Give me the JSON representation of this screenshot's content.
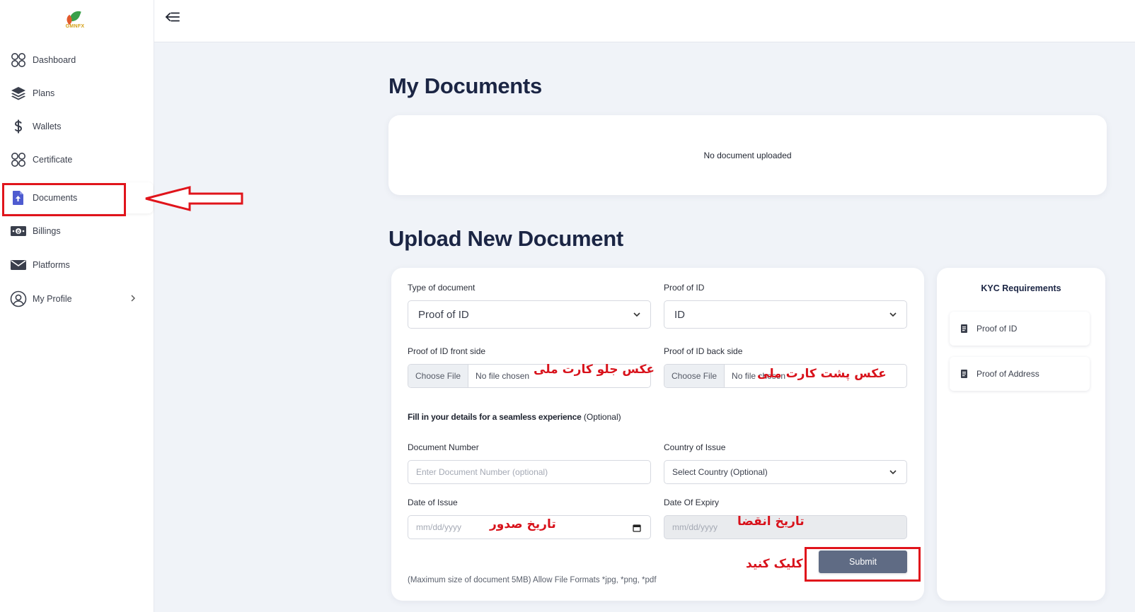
{
  "logo": {
    "text": "GMNFX"
  },
  "sidebar": {
    "items": [
      {
        "label": "Dashboard",
        "icon": "grid-icon"
      },
      {
        "label": "Plans",
        "icon": "layers-icon"
      },
      {
        "label": "Wallets",
        "icon": "dollar-icon"
      },
      {
        "label": "Certificate",
        "icon": "grid-icon"
      },
      {
        "label": "Documents",
        "icon": "file-upload-icon"
      },
      {
        "label": "Billings",
        "icon": "banknote-icon"
      },
      {
        "label": "Platforms",
        "icon": "mail-icon"
      },
      {
        "label": "My Profile",
        "icon": "user-circle-icon"
      }
    ],
    "active": "Documents"
  },
  "main": {
    "my_documents_title": "My Documents",
    "no_document_text": "No document uploaded",
    "upload_title": "Upload New Document"
  },
  "form": {
    "type_label": "Type of document",
    "type_value": "Proof of ID",
    "proof_label": "Proof of ID",
    "proof_value": "ID",
    "front_label": "Proof of ID front side",
    "back_label": "Proof of ID back side",
    "choose_file": "Choose File",
    "no_file": "No file chosen",
    "fill_note_bold": "Fill in your details for a seamless experience",
    "fill_note_optional": "(Optional)",
    "doc_number_label": "Document Number",
    "doc_number_placeholder": "Enter Document Number (optional)",
    "country_label": "Country of Issue",
    "country_value": "Select Country (Optional)",
    "issue_label": "Date of Issue",
    "issue_placeholder": "mm/dd/yyyy",
    "expiry_label": "Date Of Expiry",
    "expiry_placeholder": "mm/dd/yyyy",
    "submit_label": "Submit",
    "size_note": "(Maximum size of document 5MB) Allow File Formats *jpg, *png, *pdf"
  },
  "kyc": {
    "title": "KYC Requirements",
    "items": [
      "Proof of ID",
      "Proof of Address"
    ]
  },
  "annotations": {
    "front": "عکس جلو کارت ملی",
    "back": "عکس پشت کارت ملی",
    "issue": "تاریخ صدور",
    "expiry": "تاریخ انقضا",
    "click": "کلیک کنید"
  },
  "colors": {
    "annotation_red": "#e0141b",
    "submit_bg": "#5f6b84",
    "title_navy": "#1b2544",
    "page_bg": "#f0f3f8"
  }
}
